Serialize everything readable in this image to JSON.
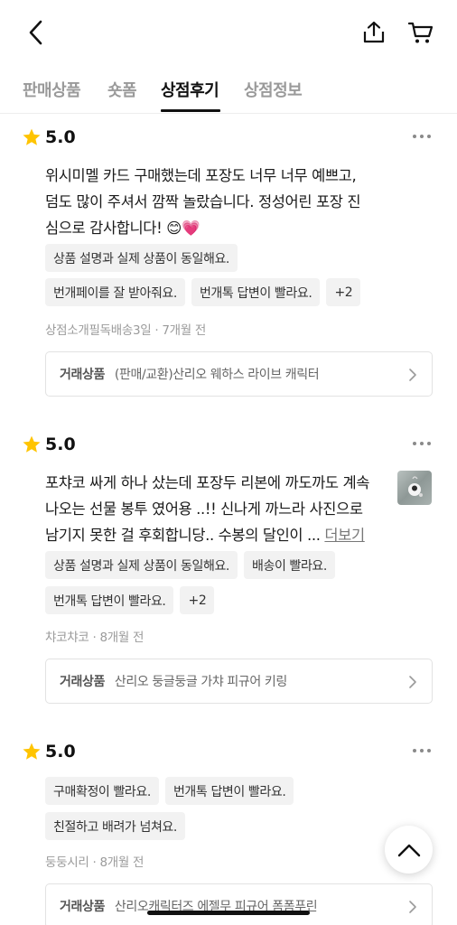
{
  "header": {
    "back_icon": "chevron-left-icon",
    "share_icon": "share-upload-icon",
    "cart_icon": "cart-icon"
  },
  "tabs": [
    {
      "label": "판매상품",
      "active": false
    },
    {
      "label": "숏폼",
      "active": false
    },
    {
      "label": "상점후기",
      "active": true
    },
    {
      "label": "상점정보",
      "active": false
    }
  ],
  "reviews": [
    {
      "rating": "5.0",
      "text_lines": [
        "위시미멜 카드 구매했는데 포장도 너무 너무 예쁘고,",
        "덤도 많이 주셔서 깜짝 놀랐습니다. 정성어린 포장 진",
        "심으로 감사합니다! 😊💗"
      ],
      "more_label": "",
      "has_photo": false,
      "chip_rows": [
        [
          "상품 설명과 실제 상품이 동일해요."
        ],
        [
          "번개페이를 잘 받아줘요.",
          "번개톡 답변이 빨라요.",
          "+2"
        ]
      ],
      "author": "상점소개필독배송3일",
      "time": "7개월 전",
      "product_label": "거래상품",
      "product_name": "(판매/교환)산리오 웨하스 라이브 캐릭터"
    },
    {
      "rating": "5.0",
      "text_lines": [
        "포챠코 싸게 하나 샀는데 포장두 리본에 까도까도 계속",
        "나오는 선물 봉투 였어용 ..!! 신나게 까느라 사진으로",
        "남기지 못한 걸 후회합니당.. 수봉의 달인이 ... "
      ],
      "more_label": "더보기",
      "has_photo": true,
      "chip_rows": [
        [
          "상품 설명과 실제 상품이 동일해요.",
          "배송이 빨라요."
        ],
        [
          "번개톡 답변이 빨라요.",
          "+2"
        ]
      ],
      "author": "챠코챠코",
      "time": "8개월 전",
      "product_label": "거래상품",
      "product_name": "산리오 둥글둥글 가챠 피규어 키링"
    },
    {
      "rating": "5.0",
      "text_lines": [],
      "more_label": "",
      "has_photo": false,
      "chip_rows": [
        [
          "구매확정이 빨라요.",
          "번개톡 답변이 빨라요."
        ],
        [
          "친절하고 배려가 넘쳐요."
        ]
      ],
      "author": "둥둥시리",
      "time": "8개월 전",
      "product_label": "거래상품",
      "product_name": "산리오캐릭터즈 에젤무 피규어 폼폼푸린"
    }
  ],
  "scroll_top_icon": "chevron-up-icon",
  "colors": {
    "star": "#FFC400",
    "accent_text": "#111111",
    "muted": "#9b9b9b",
    "chip_bg": "#f2f2f2"
  }
}
